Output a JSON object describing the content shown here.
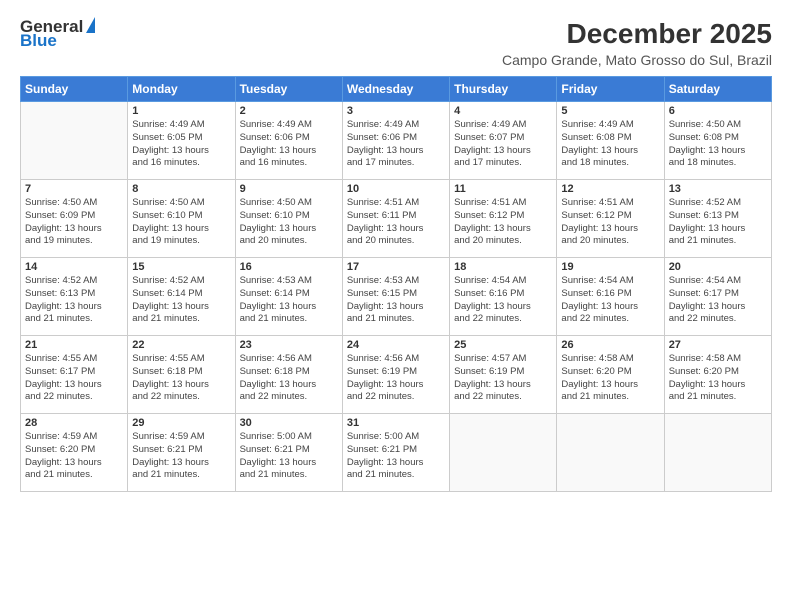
{
  "header": {
    "logo_general": "General",
    "logo_blue": "Blue",
    "title": "December 2025",
    "subtitle": "Campo Grande, Mato Grosso do Sul, Brazil"
  },
  "calendar": {
    "days_of_week": [
      "Sunday",
      "Monday",
      "Tuesday",
      "Wednesday",
      "Thursday",
      "Friday",
      "Saturday"
    ],
    "weeks": [
      [
        {
          "day": "",
          "info": ""
        },
        {
          "day": "1",
          "info": "Sunrise: 4:49 AM\nSunset: 6:05 PM\nDaylight: 13 hours\nand 16 minutes."
        },
        {
          "day": "2",
          "info": "Sunrise: 4:49 AM\nSunset: 6:06 PM\nDaylight: 13 hours\nand 16 minutes."
        },
        {
          "day": "3",
          "info": "Sunrise: 4:49 AM\nSunset: 6:06 PM\nDaylight: 13 hours\nand 17 minutes."
        },
        {
          "day": "4",
          "info": "Sunrise: 4:49 AM\nSunset: 6:07 PM\nDaylight: 13 hours\nand 17 minutes."
        },
        {
          "day": "5",
          "info": "Sunrise: 4:49 AM\nSunset: 6:08 PM\nDaylight: 13 hours\nand 18 minutes."
        },
        {
          "day": "6",
          "info": "Sunrise: 4:50 AM\nSunset: 6:08 PM\nDaylight: 13 hours\nand 18 minutes."
        }
      ],
      [
        {
          "day": "7",
          "info": "Sunrise: 4:50 AM\nSunset: 6:09 PM\nDaylight: 13 hours\nand 19 minutes."
        },
        {
          "day": "8",
          "info": "Sunrise: 4:50 AM\nSunset: 6:10 PM\nDaylight: 13 hours\nand 19 minutes."
        },
        {
          "day": "9",
          "info": "Sunrise: 4:50 AM\nSunset: 6:10 PM\nDaylight: 13 hours\nand 20 minutes."
        },
        {
          "day": "10",
          "info": "Sunrise: 4:51 AM\nSunset: 6:11 PM\nDaylight: 13 hours\nand 20 minutes."
        },
        {
          "day": "11",
          "info": "Sunrise: 4:51 AM\nSunset: 6:12 PM\nDaylight: 13 hours\nand 20 minutes."
        },
        {
          "day": "12",
          "info": "Sunrise: 4:51 AM\nSunset: 6:12 PM\nDaylight: 13 hours\nand 20 minutes."
        },
        {
          "day": "13",
          "info": "Sunrise: 4:52 AM\nSunset: 6:13 PM\nDaylight: 13 hours\nand 21 minutes."
        }
      ],
      [
        {
          "day": "14",
          "info": "Sunrise: 4:52 AM\nSunset: 6:13 PM\nDaylight: 13 hours\nand 21 minutes."
        },
        {
          "day": "15",
          "info": "Sunrise: 4:52 AM\nSunset: 6:14 PM\nDaylight: 13 hours\nand 21 minutes."
        },
        {
          "day": "16",
          "info": "Sunrise: 4:53 AM\nSunset: 6:14 PM\nDaylight: 13 hours\nand 21 minutes."
        },
        {
          "day": "17",
          "info": "Sunrise: 4:53 AM\nSunset: 6:15 PM\nDaylight: 13 hours\nand 21 minutes."
        },
        {
          "day": "18",
          "info": "Sunrise: 4:54 AM\nSunset: 6:16 PM\nDaylight: 13 hours\nand 22 minutes."
        },
        {
          "day": "19",
          "info": "Sunrise: 4:54 AM\nSunset: 6:16 PM\nDaylight: 13 hours\nand 22 minutes."
        },
        {
          "day": "20",
          "info": "Sunrise: 4:54 AM\nSunset: 6:17 PM\nDaylight: 13 hours\nand 22 minutes."
        }
      ],
      [
        {
          "day": "21",
          "info": "Sunrise: 4:55 AM\nSunset: 6:17 PM\nDaylight: 13 hours\nand 22 minutes."
        },
        {
          "day": "22",
          "info": "Sunrise: 4:55 AM\nSunset: 6:18 PM\nDaylight: 13 hours\nand 22 minutes."
        },
        {
          "day": "23",
          "info": "Sunrise: 4:56 AM\nSunset: 6:18 PM\nDaylight: 13 hours\nand 22 minutes."
        },
        {
          "day": "24",
          "info": "Sunrise: 4:56 AM\nSunset: 6:19 PM\nDaylight: 13 hours\nand 22 minutes."
        },
        {
          "day": "25",
          "info": "Sunrise: 4:57 AM\nSunset: 6:19 PM\nDaylight: 13 hours\nand 22 minutes."
        },
        {
          "day": "26",
          "info": "Sunrise: 4:58 AM\nSunset: 6:20 PM\nDaylight: 13 hours\nand 21 minutes."
        },
        {
          "day": "27",
          "info": "Sunrise: 4:58 AM\nSunset: 6:20 PM\nDaylight: 13 hours\nand 21 minutes."
        }
      ],
      [
        {
          "day": "28",
          "info": "Sunrise: 4:59 AM\nSunset: 6:20 PM\nDaylight: 13 hours\nand 21 minutes."
        },
        {
          "day": "29",
          "info": "Sunrise: 4:59 AM\nSunset: 6:21 PM\nDaylight: 13 hours\nand 21 minutes."
        },
        {
          "day": "30",
          "info": "Sunrise: 5:00 AM\nSunset: 6:21 PM\nDaylight: 13 hours\nand 21 minutes."
        },
        {
          "day": "31",
          "info": "Sunrise: 5:00 AM\nSunset: 6:21 PM\nDaylight: 13 hours\nand 21 minutes."
        },
        {
          "day": "",
          "info": ""
        },
        {
          "day": "",
          "info": ""
        },
        {
          "day": "",
          "info": ""
        }
      ]
    ]
  }
}
